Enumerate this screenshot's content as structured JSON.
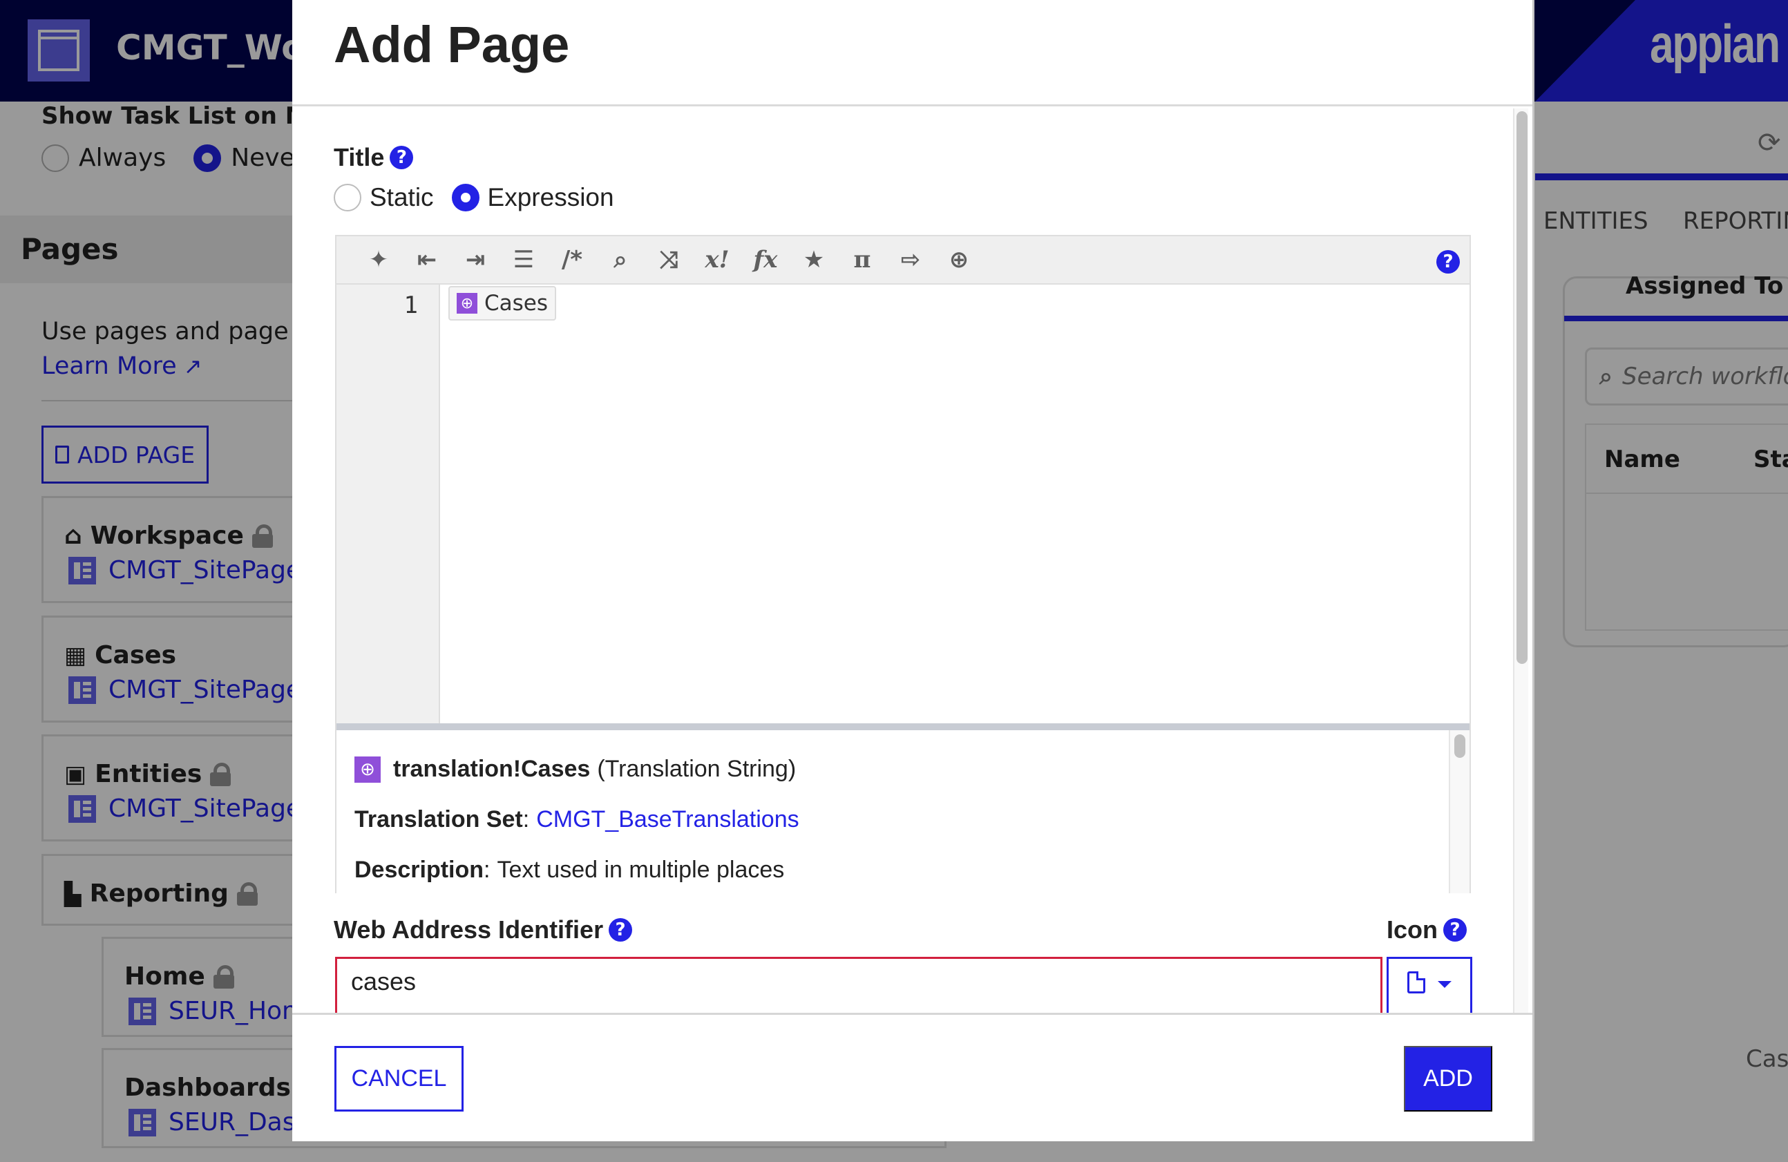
{
  "background": {
    "app_title": "CMGT_Workspace",
    "brand": "appian",
    "setting_label": "Show Task List on Mobile",
    "setting_options": [
      {
        "label": "Always",
        "selected": false
      },
      {
        "label": "Never",
        "selected": true
      }
    ],
    "pages_heading": "Pages",
    "pages_description": "Use pages and page groups",
    "learn_more": "Learn More",
    "add_page_button": "ADD PAGE",
    "page_cards": [
      {
        "name": "Workspace",
        "icon": "home-icon",
        "locked": true,
        "link": "CMGT_SitePage_Workspace"
      },
      {
        "name": "Cases",
        "icon": "table-icon",
        "locked": false,
        "link": "CMGT_SitePage_Cases"
      },
      {
        "name": "Entities",
        "icon": "contact-book-icon",
        "locked": true,
        "link": "CMGT_SitePage_Entities"
      },
      {
        "name": "Reporting",
        "icon": "bar-chart-icon",
        "locked": true,
        "link": ""
      },
      {
        "name": "Home",
        "icon": "",
        "locked": true,
        "link": "SEUR_Home"
      },
      {
        "name": "Dashboards",
        "icon": "",
        "locked": true,
        "link": "SEUR_Dashboards"
      }
    ],
    "right_tabs": [
      "ENTITIES",
      "REPORTING"
    ],
    "right_panel_title": "Assigned To Me",
    "right_search_placeholder": "Search workflows",
    "right_grid_columns": [
      "Name",
      "Status"
    ],
    "right_footer_text": "Cases"
  },
  "modal": {
    "title": "Add Page",
    "title_field": {
      "label": "Title",
      "mode_options": [
        {
          "label": "Static",
          "selected": false
        },
        {
          "label": "Expression",
          "selected": true
        }
      ]
    },
    "editor": {
      "toolbar_icons": [
        "magic-wand-icon",
        "outdent-icon",
        "indent-icon",
        "format-icon",
        "comment-icon",
        "search-icon",
        "shuffle-icon",
        "variable-icon",
        "function-icon",
        "star-icon",
        "pi-icon",
        "export-icon",
        "translation-icon"
      ],
      "toolbar_glyphs": [
        "✦",
        "⇤",
        "⇥",
        "☰",
        "/*",
        "⌕",
        "⤨",
        "x!",
        "fx",
        "★",
        "π",
        "⇨",
        "⊕"
      ],
      "line_number": "1",
      "token_text": "Cases"
    },
    "doc_panel": {
      "name": "translation!Cases",
      "type": "(Translation String)",
      "set_label": "Translation Set",
      "set_value": "CMGT_BaseTranslations",
      "desc_label": "Description",
      "desc_value": "Text used in multiple places"
    },
    "web_address": {
      "label": "Web Address Identifier",
      "value": "cases"
    },
    "icon_field": {
      "label": "Icon",
      "selected_icon": "file-icon"
    },
    "cancel_label": "CANCEL",
    "add_label": "ADD"
  },
  "colors": {
    "accent": "#2322e5",
    "error": "#d2203e",
    "translation_badge": "#8f4fd9"
  }
}
